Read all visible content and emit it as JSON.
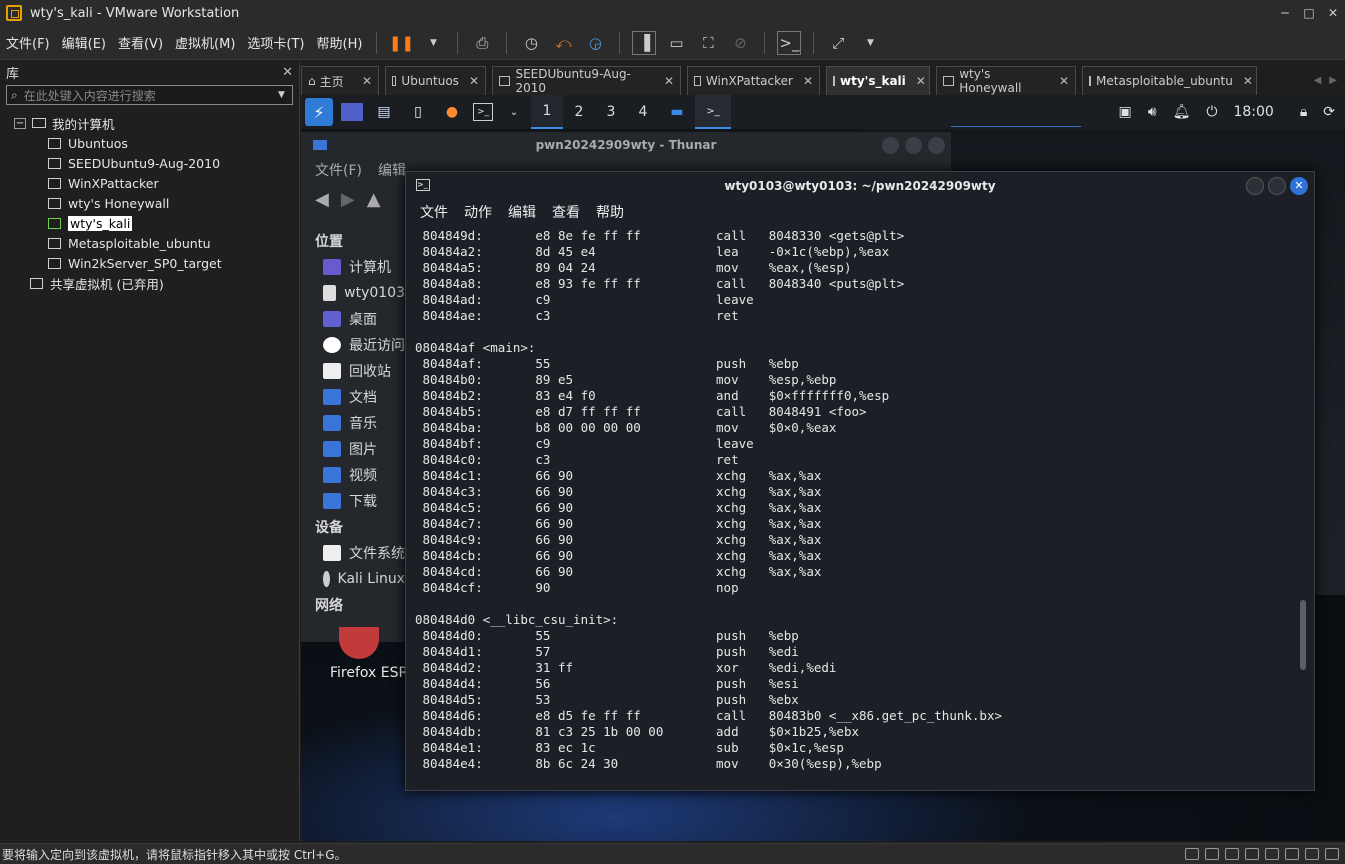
{
  "window": {
    "title": "wty's_kali - VMware Workstation"
  },
  "menu": [
    "文件(F)",
    "编辑(E)",
    "查看(V)",
    "虚拟机(M)",
    "选项卡(T)",
    "帮助(H)"
  ],
  "library": {
    "title": "库",
    "search_placeholder": "在此处键入内容进行搜索",
    "root": "我的计算机",
    "vms": [
      "Ubuntuos",
      "SEEDUbuntu9-Aug-2010",
      "WinXPattacker",
      "wty's Honeywall",
      "wty's_kali",
      "Metasploitable_ubuntu",
      "Win2kServer_SP0_target"
    ],
    "selected": "wty's_kali",
    "shared": "共享虚拟机 (已弃用)"
  },
  "tabs": [
    {
      "label": "主页"
    },
    {
      "label": "Ubuntuos"
    },
    {
      "label": "SEEDUbuntu9-Aug-2010"
    },
    {
      "label": "WinXPattacker"
    },
    {
      "label": "wty's_kali"
    },
    {
      "label": "wty's Honeywall"
    },
    {
      "label": "Metasploitable_ubuntu"
    }
  ],
  "guest_panel": {
    "workspaces": [
      "1",
      "2",
      "3",
      "4"
    ],
    "clock": "18:00"
  },
  "thunar": {
    "title": "pwn20242909wty - Thunar",
    "menu": [
      "文件(F)",
      "编辑"
    ],
    "places_header": "位置",
    "places": [
      "计算机",
      "wty0103",
      "桌面",
      "最近访问",
      "回收站",
      "文档",
      "音乐",
      "图片",
      "视频",
      "下载"
    ],
    "devices_header": "设备",
    "devices": [
      "文件系统",
      "Kali Linux"
    ],
    "network_header": "网络",
    "firefox": "Firefox ESR"
  },
  "terminal": {
    "title": "wty0103@wty0103: ~/pwn20242909wty",
    "menu": [
      "文件",
      "动作",
      "编辑",
      "查看",
      "帮助"
    ],
    "lines": [
      " 804849d:       e8 8e fe ff ff          call   8048330 <gets@plt>",
      " 80484a2:       8d 45 e4                lea    -0×1c(%ebp),%eax",
      " 80484a5:       89 04 24                mov    %eax,(%esp)",
      " 80484a8:       e8 93 fe ff ff          call   8048340 <puts@plt>",
      " 80484ad:       c9                      leave",
      " 80484ae:       c3                      ret",
      "",
      "080484af <main>:",
      " 80484af:       55                      push   %ebp",
      " 80484b0:       89 e5                   mov    %esp,%ebp",
      " 80484b2:       83 e4 f0                and    $0×fffffff0,%esp",
      " 80484b5:       e8 d7 ff ff ff          call   8048491 <foo>",
      " 80484ba:       b8 00 00 00 00          mov    $0×0,%eax",
      " 80484bf:       c9                      leave",
      " 80484c0:       c3                      ret",
      " 80484c1:       66 90                   xchg   %ax,%ax",
      " 80484c3:       66 90                   xchg   %ax,%ax",
      " 80484c5:       66 90                   xchg   %ax,%ax",
      " 80484c7:       66 90                   xchg   %ax,%ax",
      " 80484c9:       66 90                   xchg   %ax,%ax",
      " 80484cb:       66 90                   xchg   %ax,%ax",
      " 80484cd:       66 90                   xchg   %ax,%ax",
      " 80484cf:       90                      nop",
      "",
      "080484d0 <__libc_csu_init>:",
      " 80484d0:       55                      push   %ebp",
      " 80484d1:       57                      push   %edi",
      " 80484d2:       31 ff                   xor    %edi,%edi",
      " 80484d4:       56                      push   %esi",
      " 80484d5:       53                      push   %ebx",
      " 80484d6:       e8 d5 fe ff ff          call   80483b0 <__x86.get_pc_thunk.bx>",
      " 80484db:       81 c3 25 1b 00 00       add    $0×1b25,%ebx",
      " 80484e1:       83 ec 1c                sub    $0×1c,%esp",
      " 80484e4:       8b 6c 24 30             mov    0×30(%esp),%ebp"
    ]
  },
  "statusbar": {
    "text": "要将输入定向到该虚拟机，请将鼠标指针移入其中或按 Ctrl+G。"
  }
}
